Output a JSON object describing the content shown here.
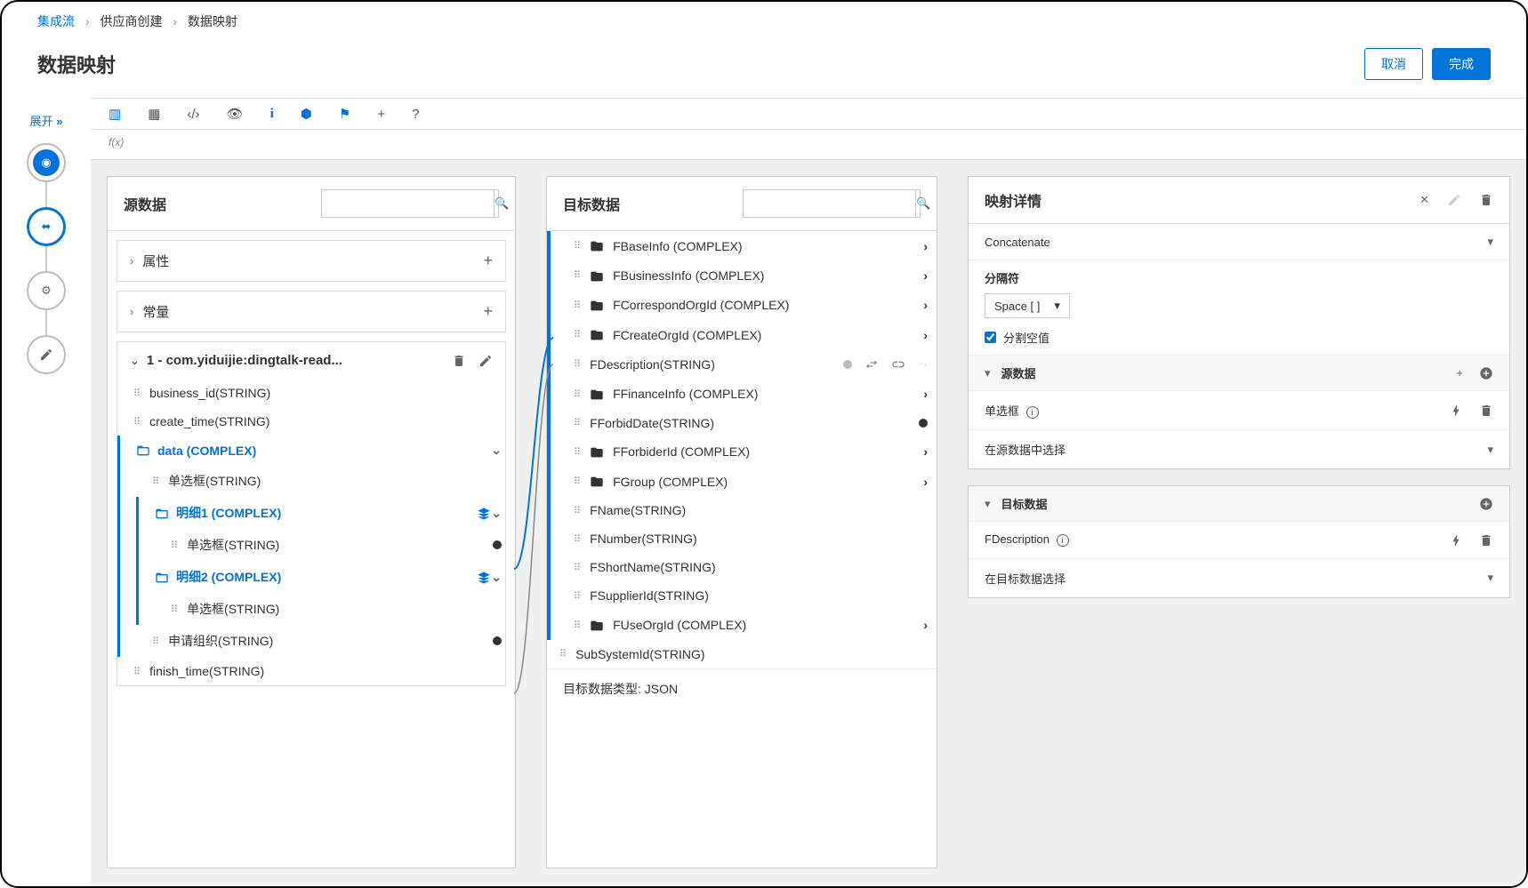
{
  "breadcrumb": {
    "a": "集成流",
    "b": "供应商创建",
    "c": "数据映射"
  },
  "pageTitle": "数据映射",
  "buttons": {
    "cancel": "取消",
    "done": "完成"
  },
  "sidebar": {
    "expand": "展开"
  },
  "fx": "f(x)",
  "source": {
    "title": "源数据",
    "attr": "属性",
    "const": "常量",
    "rootName": "1 - com.yiduijie:dingtalk-read...",
    "items": {
      "business_id": "business_id(STRING)",
      "create_time": "create_time(STRING)",
      "data": "data (COMPLEX)",
      "danxuan": "单选框(STRING)",
      "mingxi1": "明细1 (COMPLEX)",
      "danxuan2": "单选框(STRING)",
      "mingxi2": "明细2 (COMPLEX)",
      "danxuan3": "单选框(STRING)",
      "shenqing": "申请组织(STRING)",
      "finish_time": "finish_time(STRING)"
    }
  },
  "target": {
    "title": "目标数据",
    "footer": "目标数据类型: JSON",
    "items": {
      "FBaseInfo": "FBaseInfo (COMPLEX)",
      "FBusinessInfo": "FBusinessInfo (COMPLEX)",
      "FCorrespondOrgId": "FCorrespondOrgId (COMPLEX)",
      "FCreateOrgId": "FCreateOrgId (COMPLEX)",
      "FDescription": "FDescription(STRING)",
      "FFinanceInfo": "FFinanceInfo (COMPLEX)",
      "FForbidDate": "FForbidDate(STRING)",
      "FForbiderId": "FForbiderId (COMPLEX)",
      "FGroup": "FGroup (COMPLEX)",
      "FName": "FName(STRING)",
      "FNumber": "FNumber(STRING)",
      "FShortName": "FShortName(STRING)",
      "FSupplierId": "FSupplierId(STRING)",
      "FUseOrgId": "FUseOrgId (COMPLEX)",
      "SubSystemId": "SubSystemId(STRING)"
    }
  },
  "details": {
    "title": "映射详情",
    "transform": "Concatenate",
    "delimiterLabel": "分隔符",
    "delimiterValue": "Space [ ]",
    "splitNull": "分割空值",
    "sourceSection": "源数据",
    "sourceItem": "单选框",
    "sourceSelect": "在源数据中选择",
    "targetSection": "目标数据",
    "targetItem": "FDescription",
    "targetSelect": "在目标数据选择"
  }
}
